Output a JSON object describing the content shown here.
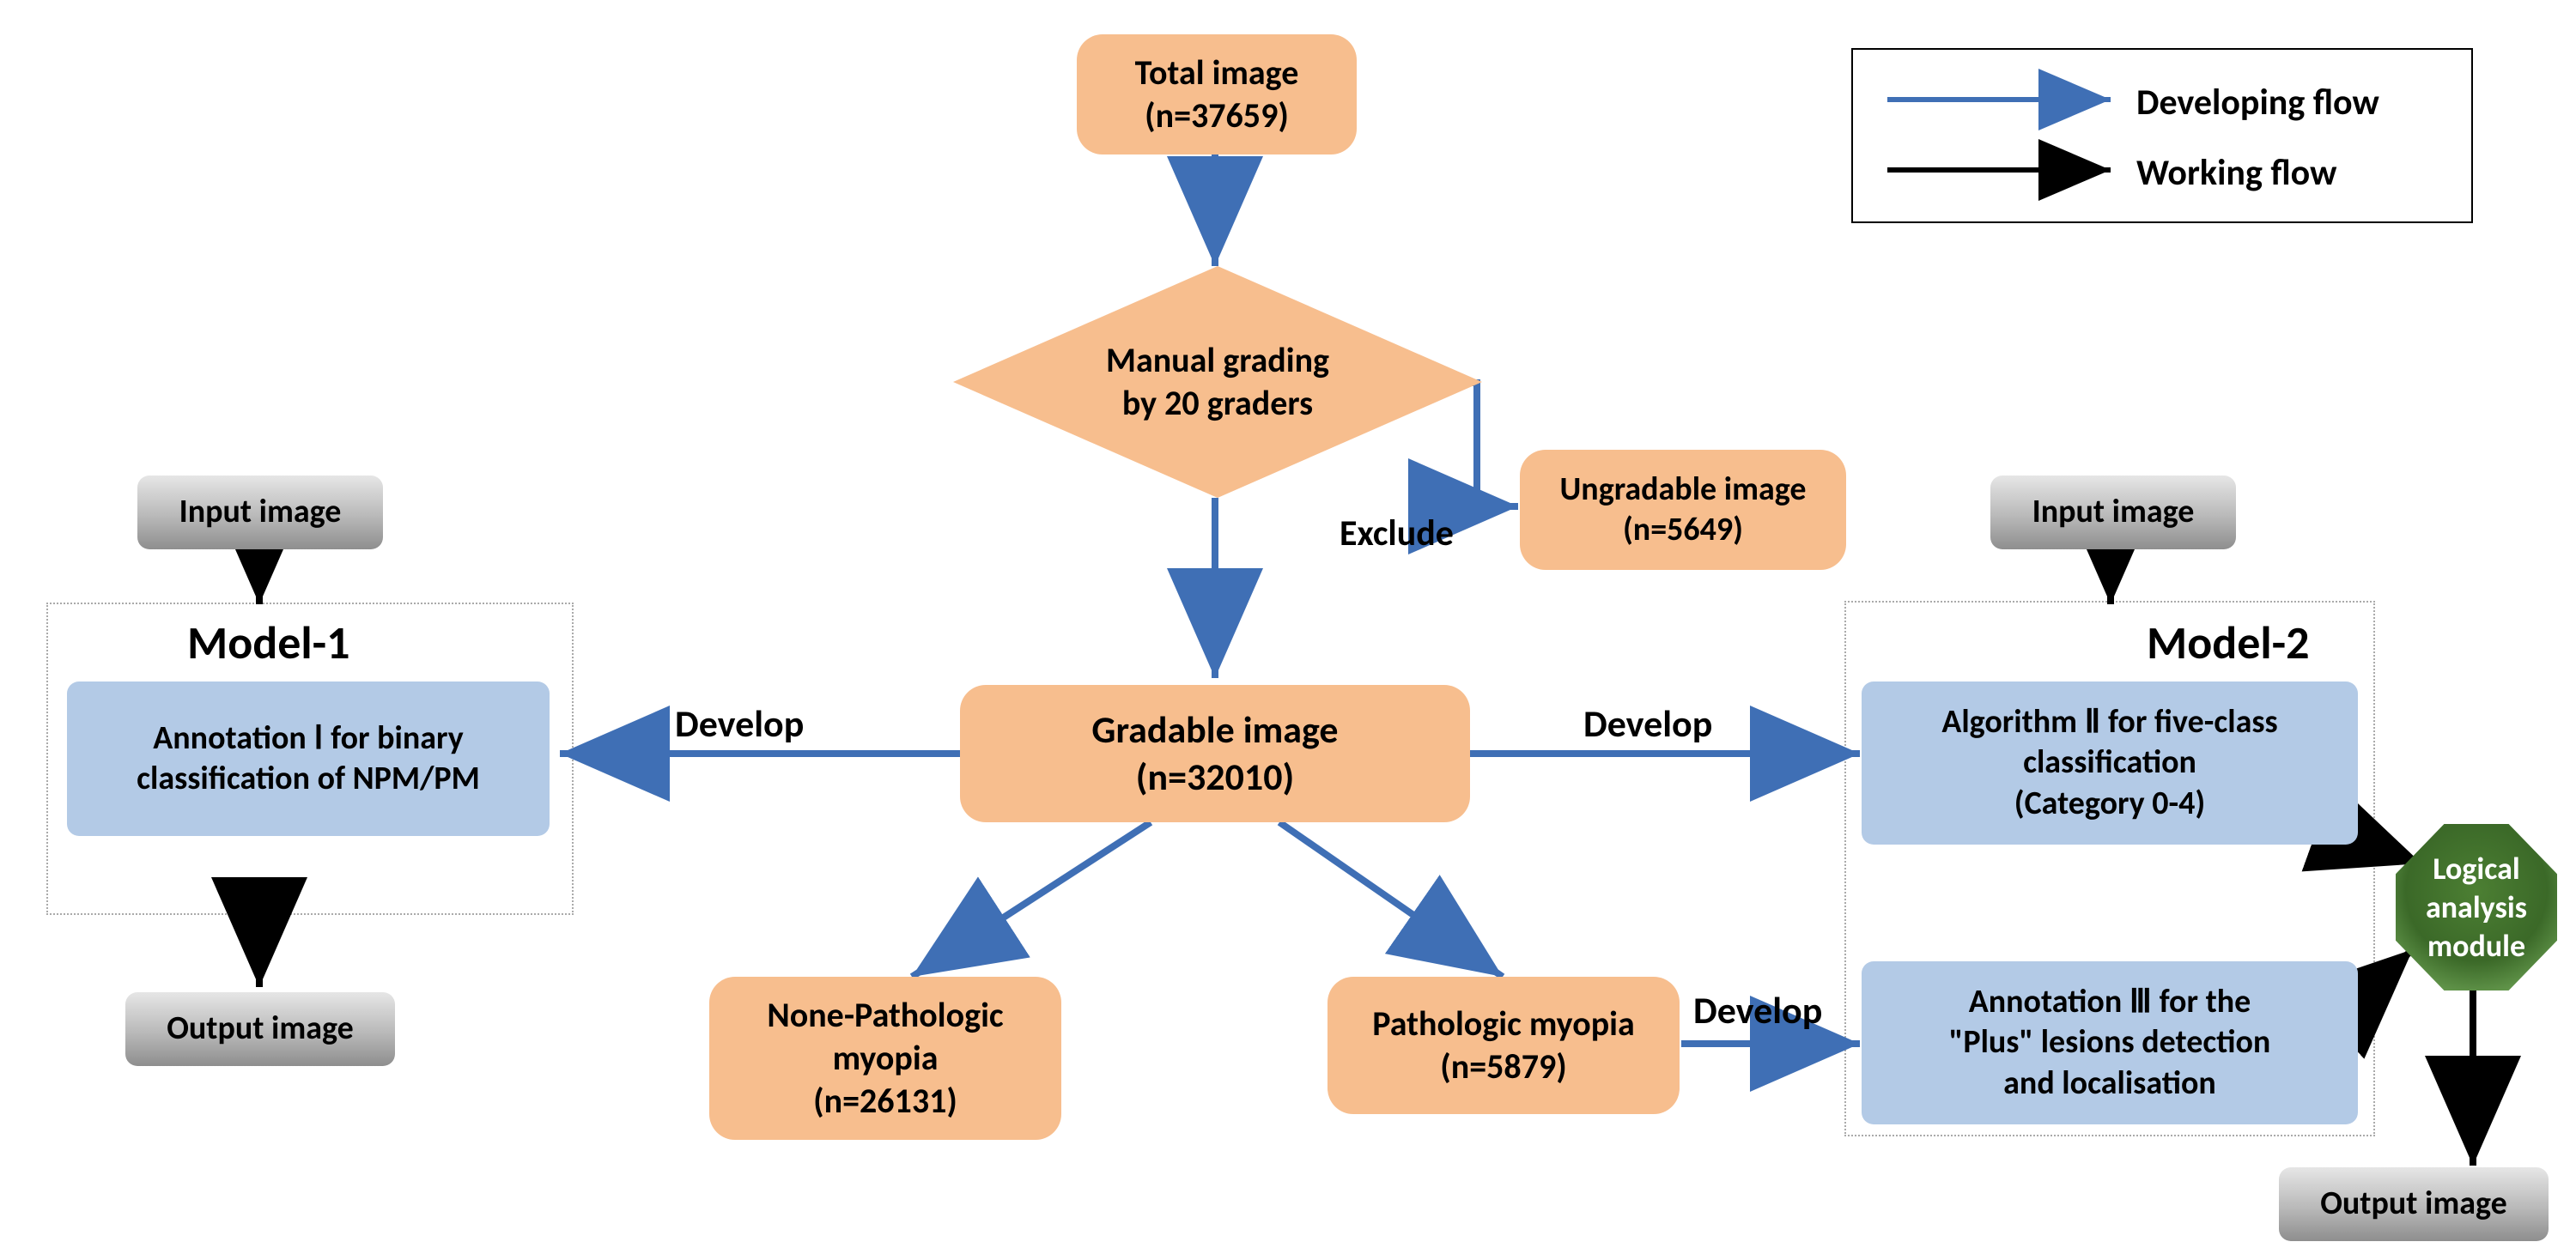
{
  "chart_data": {
    "type": "diagram",
    "nodes": [
      {
        "id": "total",
        "label": "Total image\n(n=37659)",
        "color": "orange",
        "shape": "roundrect"
      },
      {
        "id": "manual",
        "label": "Manual grading\nby 20 graders",
        "color": "orange",
        "shape": "diamond"
      },
      {
        "id": "ungradable",
        "label": "Ungradable image\n(n=5649)",
        "color": "orange",
        "shape": "roundrect"
      },
      {
        "id": "gradable",
        "label": "Gradable image\n(n=32010)",
        "color": "orange",
        "shape": "roundrect"
      },
      {
        "id": "npm",
        "label": "None-Pathologic\nmyopia\n(n=26131)",
        "color": "orange",
        "shape": "roundrect"
      },
      {
        "id": "pm",
        "label": "Pathologic myopia\n(n=5879)",
        "color": "orange",
        "shape": "roundrect"
      },
      {
        "id": "ann1",
        "label": "Annotation Ⅰ for binary\nclassification of  NPM/PM",
        "color": "blue",
        "shape": "roundrect"
      },
      {
        "id": "alg2",
        "label": "Algorithm Ⅱ for five-class\nclassification\n(Category 0-4)",
        "color": "blue",
        "shape": "roundrect"
      },
      {
        "id": "ann3",
        "label": "Annotation Ⅲ for the\n\"Plus\" lesions detection\nand localisation",
        "color": "blue",
        "shape": "roundrect"
      },
      {
        "id": "logic",
        "label": "Logical\nanalysis\nmodule",
        "color": "green",
        "shape": "octagon"
      },
      {
        "id": "in1",
        "label": "Input image",
        "color": "grey",
        "shape": "roundrect"
      },
      {
        "id": "out1",
        "label": "Output image",
        "color": "grey",
        "shape": "roundrect"
      },
      {
        "id": "in2",
        "label": "Input image",
        "color": "grey",
        "shape": "roundrect"
      },
      {
        "id": "out2",
        "label": "Output image",
        "color": "grey",
        "shape": "roundrect"
      }
    ],
    "edges": [
      {
        "from": "total",
        "to": "manual",
        "label": "",
        "color": "blue"
      },
      {
        "from": "manual",
        "to": "gradable",
        "label": "",
        "color": "blue"
      },
      {
        "from": "manual",
        "to": "ungradable",
        "label": "Exclude",
        "color": "blue"
      },
      {
        "from": "gradable",
        "to": "ann1",
        "label": "Develop",
        "color": "blue"
      },
      {
        "from": "gradable",
        "to": "alg2",
        "label": "Develop",
        "color": "blue"
      },
      {
        "from": "gradable",
        "to": "npm",
        "label": "",
        "color": "blue"
      },
      {
        "from": "gradable",
        "to": "pm",
        "label": "",
        "color": "blue"
      },
      {
        "from": "pm",
        "to": "ann3",
        "label": "Develop",
        "color": "blue"
      },
      {
        "from": "alg2",
        "to": "logic",
        "label": "",
        "color": "black"
      },
      {
        "from": "ann3",
        "to": "logic",
        "label": "",
        "color": "black"
      },
      {
        "from": "in1",
        "to": "ann1",
        "label": "",
        "color": "black",
        "container": "Model-1"
      },
      {
        "from": "ann1",
        "to": "out1",
        "label": "",
        "color": "black"
      },
      {
        "from": "in2",
        "to": "alg2",
        "label": "",
        "color": "black",
        "container": "Model-2"
      },
      {
        "from": "logic",
        "to": "out2",
        "label": "",
        "color": "black"
      }
    ],
    "containers": [
      {
        "id": "model1",
        "label": "Model-1",
        "members": [
          "ann1"
        ]
      },
      {
        "id": "model2",
        "label": "Model-2",
        "members": [
          "alg2",
          "ann3"
        ]
      }
    ],
    "legend": {
      "items": [
        {
          "color": "blue",
          "label": "Developing flow"
        },
        {
          "color": "black",
          "label": "Working flow"
        }
      ]
    }
  },
  "nodes": {
    "total": {
      "l1": "Total image",
      "l2": "(n=37659)"
    },
    "manual": {
      "l1": "Manual grading",
      "l2": "by 20 graders"
    },
    "ungradable": {
      "l1": "Ungradable image",
      "l2": "(n=5649)"
    },
    "gradable": {
      "l1": "Gradable image",
      "l2": "(n=32010)"
    },
    "npm": {
      "l1": "None-Pathologic",
      "l2": "myopia",
      "l3": "(n=26131)"
    },
    "pm": {
      "l1": "Pathologic myopia",
      "l2": "(n=5879)"
    },
    "ann1": {
      "l1": "Annotation Ⅰ for binary",
      "l2": "classification of  NPM/PM"
    },
    "alg2": {
      "l1": "Algorithm Ⅱ for five-class",
      "l2": "classification",
      "l3": "(Category 0-4)"
    },
    "ann3": {
      "l1": "Annotation Ⅲ for the",
      "l2": "\"Plus\" lesions detection",
      "l3": "and localisation"
    },
    "logic": {
      "l1": "Logical",
      "l2": "analysis",
      "l3": "module"
    },
    "in1": {
      "l1": "Input image"
    },
    "out1": {
      "l1": "Output image"
    },
    "in2": {
      "l1": "Input image"
    },
    "out2": {
      "l1": "Output image"
    }
  },
  "labels": {
    "model1": "Model-1",
    "model2": "Model-2",
    "develop": "Develop",
    "exclude": "Exclude"
  },
  "legend": {
    "dev": "Developing flow",
    "work": "Working flow"
  }
}
